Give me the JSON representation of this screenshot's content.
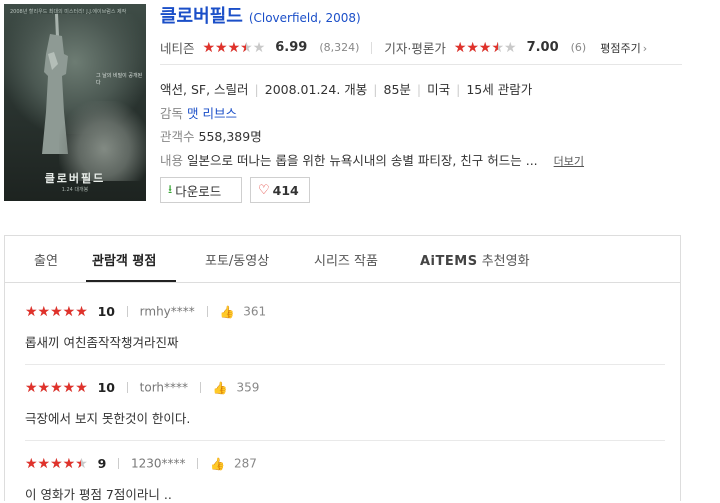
{
  "movie": {
    "title": "클로버필드",
    "title_en": "(Cloverfield, 2008)",
    "poster": {
      "tagline": "2008년 할리우드 최대의 미스터리!   J.J.에이브럼스 제작",
      "title": "클로버필드",
      "small_text": "그 날의 비밀이 공개된다",
      "date": "1.24 대개봉"
    },
    "ratings": {
      "netizen": {
        "label": "네티즌",
        "score": "6.99",
        "count": "(8,324)",
        "fraction": 0.699
      },
      "critic": {
        "label": "기자·평론가",
        "score": "7.00",
        "count": "(6)",
        "fraction": 0.7
      },
      "rate_link": "평점주기",
      "rate_chevron": "›"
    },
    "info": {
      "genre": "액션, SF, 스릴러",
      "release": "2008.01.24. 개봉",
      "runtime": "85분",
      "country": "미국",
      "age": "15세 관람가"
    },
    "director": {
      "label": "감독",
      "name": "맷 리브스"
    },
    "audience": {
      "label": "관객수",
      "value": "558,389명"
    },
    "summary": {
      "label": "내용",
      "text": "일본으로 떠나는 롭을 위한 뉴욕시내의 송별 파티장, 친구 허드는 ...",
      "more": "더보기"
    },
    "buttons": {
      "download": "다운로드",
      "download_icon": "download-icon",
      "likes": "414",
      "heart_icon": "heart-icon"
    }
  },
  "tabs": {
    "items": [
      "출연",
      "관람객 평점",
      "포토/동영상",
      "시리즈 작품",
      "AiTEMS",
      "추천영화"
    ],
    "active": 1
  },
  "reviews": [
    {
      "score": "10",
      "fraction": 1.0,
      "user": "rmhy****",
      "likes": "361",
      "text": "롭새끼 여친좀작작챙겨라진짜"
    },
    {
      "score": "10",
      "fraction": 1.0,
      "user": "torh****",
      "likes": "359",
      "text": "극장에서 보지 못한것이 한이다."
    },
    {
      "score": "9",
      "fraction": 0.9,
      "user": "1230****",
      "likes": "287",
      "text": "이 영화가 평점 7점이라니 .."
    }
  ],
  "colors": {
    "star_active": "#e0322b",
    "link_blue": "#1b4fc8",
    "thumb": "#e8a35a"
  },
  "icons": {
    "star": "star-icon",
    "thumb": "thumb-up-icon"
  }
}
